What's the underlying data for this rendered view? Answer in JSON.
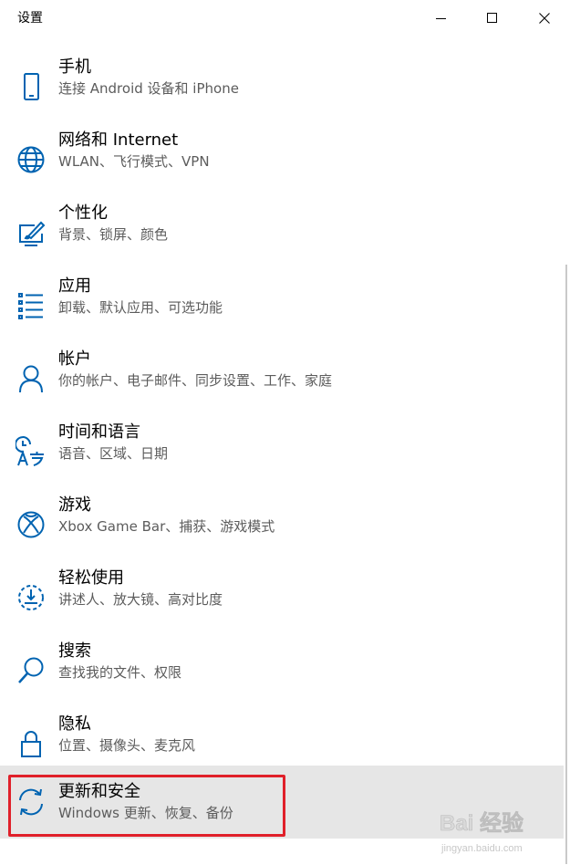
{
  "window": {
    "title": "设置"
  },
  "accent_color": "#0063b1",
  "highlight_color": "#e0202a",
  "items": [
    {
      "title": "手机",
      "desc": "连接 Android 设备和 iPhone",
      "icon": "phone-icon"
    },
    {
      "title": "网络和 Internet",
      "desc": "WLAN、飞行模式、VPN",
      "icon": "globe-icon"
    },
    {
      "title": "个性化",
      "desc": "背景、锁屏、颜色",
      "icon": "personalization-icon"
    },
    {
      "title": "应用",
      "desc": "卸载、默认应用、可选功能",
      "icon": "apps-list-icon"
    },
    {
      "title": "帐户",
      "desc": "你的帐户、电子邮件、同步设置、工作、家庭",
      "icon": "person-icon"
    },
    {
      "title": "时间和语言",
      "desc": "语音、区域、日期",
      "icon": "time-language-icon"
    },
    {
      "title": "游戏",
      "desc": "Xbox Game Bar、捕获、游戏模式",
      "icon": "xbox-icon"
    },
    {
      "title": "轻松使用",
      "desc": "讲述人、放大镜、高对比度",
      "icon": "ease-of-access-icon"
    },
    {
      "title": "搜索",
      "desc": "查找我的文件、权限",
      "icon": "search-icon"
    },
    {
      "title": "隐私",
      "desc": "位置、摄像头、麦克风",
      "icon": "lock-icon"
    },
    {
      "title": "更新和安全",
      "desc": "Windows 更新、恢复、备份",
      "icon": "sync-icon",
      "selected": true
    }
  ],
  "watermark": {
    "text": "Bai 经验",
    "url": "jingyan.baidu.com"
  }
}
